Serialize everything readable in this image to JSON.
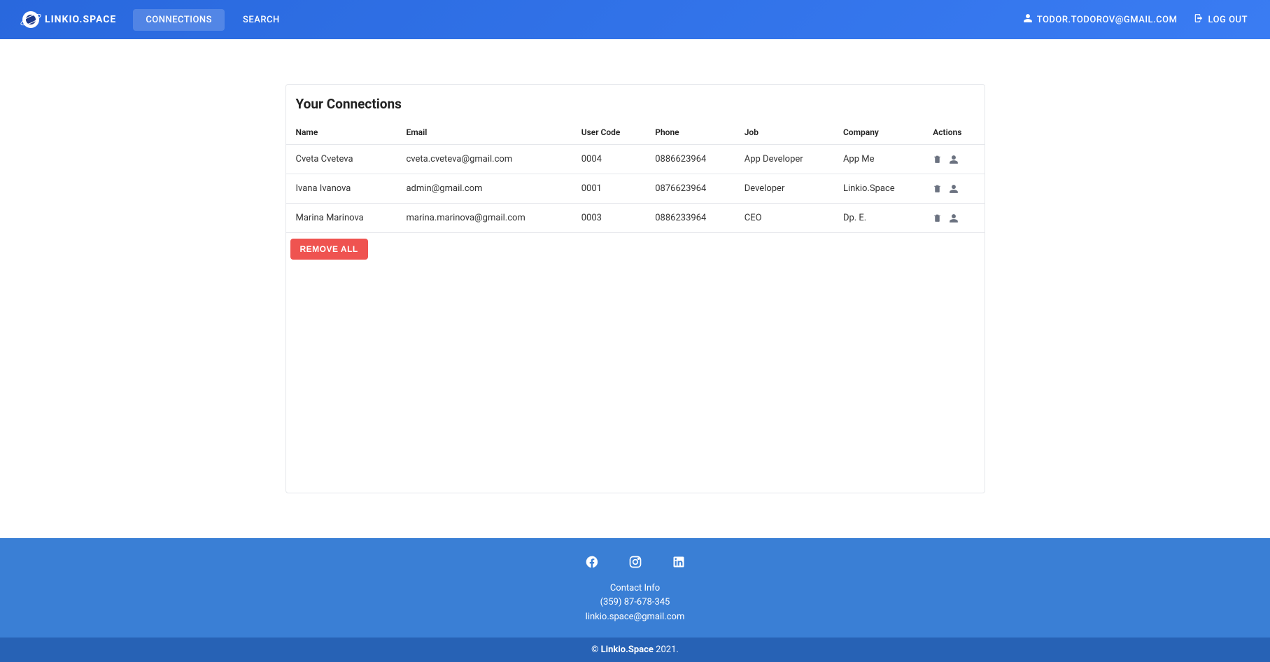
{
  "brand": "LINKIO.SPACE",
  "nav": {
    "connections": "CONNECTIONS",
    "search": "SEARCH",
    "user_email": "TODOR.TODOROV@GMAIL.COM",
    "logout": "LOG OUT"
  },
  "page": {
    "title": "Your Connections",
    "remove_all": "REMOVE ALL"
  },
  "table": {
    "headers": {
      "name": "Name",
      "email": "Email",
      "user_code": "User Code",
      "phone": "Phone",
      "job": "Job",
      "company": "Company",
      "actions": "Actions"
    },
    "rows": [
      {
        "name": "Cveta Cveteva",
        "email": "cveta.cveteva@gmail.com",
        "user_code": "0004",
        "phone": "0886623964",
        "job": "App Developer",
        "company": "App Me"
      },
      {
        "name": "Ivana Ivanova",
        "email": "admin@gmail.com",
        "user_code": "0001",
        "phone": "0876623964",
        "job": "Developer",
        "company": "Linkio.Space"
      },
      {
        "name": "Marina Marinova",
        "email": "marina.marinova@gmail.com",
        "user_code": "0003",
        "phone": "0886233964",
        "job": "CEO",
        "company": "Dp. E."
      }
    ]
  },
  "footer": {
    "contact_heading": "Contact Info",
    "phone": "(359) 87-678-345",
    "email": "linkio.space@gmail.com",
    "copyright_prefix": "© ",
    "copyright_brand": "Linkio.Space",
    "copyright_year": " 2021."
  }
}
